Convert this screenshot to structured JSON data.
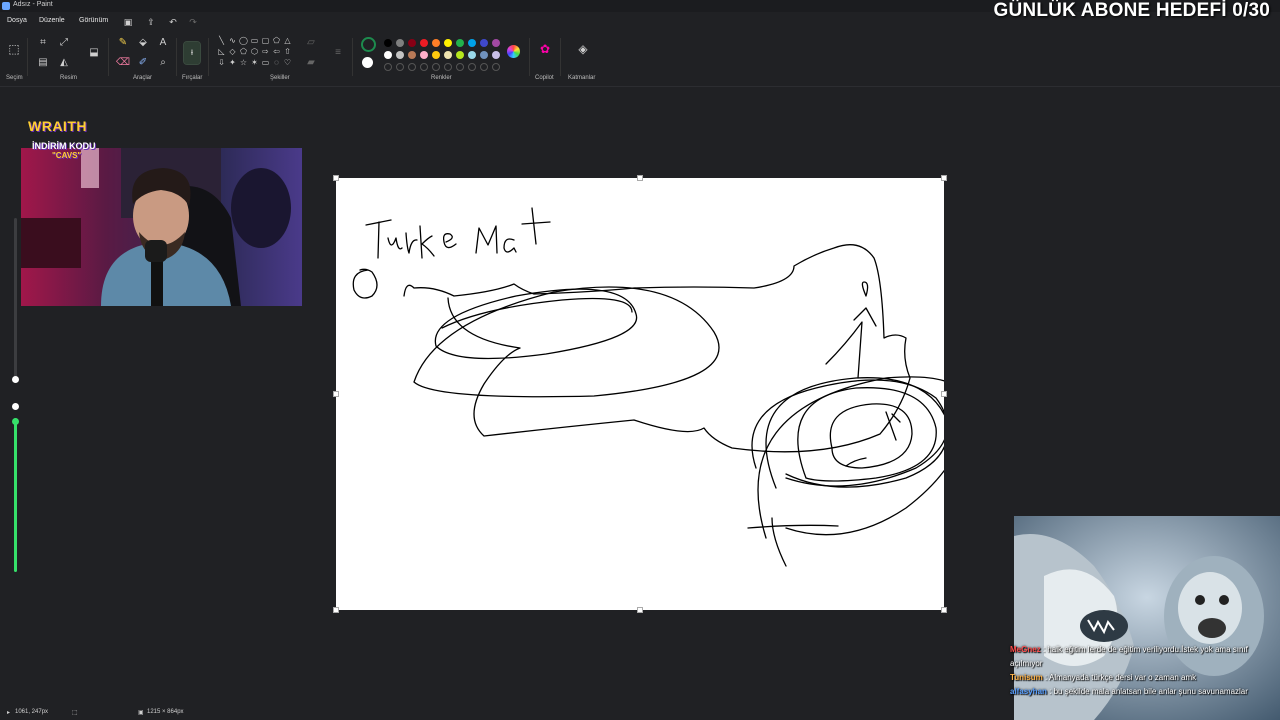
{
  "window": {
    "title": "Adsız - Paint"
  },
  "menu": {
    "file": "Dosya",
    "edit": "Düzenle",
    "view": "Görünüm"
  },
  "ribbon": {
    "groups": {
      "selection": "Seçim",
      "image": "Resim",
      "tools": "Araçlar",
      "brushes": "Fırçalar",
      "shapes": "Şekiller",
      "colors": "Renkler",
      "copilot": "Copilot",
      "layers": "Katmanlar"
    },
    "palette_row1": [
      "#000000",
      "#7f7f7f",
      "#880015",
      "#ed1c24",
      "#ff7f27",
      "#fff200",
      "#22b14c",
      "#00a2e8",
      "#3f48cc",
      "#a349a4"
    ],
    "palette_row2": [
      "#ffffff",
      "#c3c3c3",
      "#b97a57",
      "#ffaec9",
      "#ffc90e",
      "#efe4b0",
      "#b5e61d",
      "#99d9ea",
      "#7092be",
      "#c8bfe7"
    ],
    "accent_color": "#1d8b4e"
  },
  "status": {
    "cursor_position": "1061, 247px",
    "canvas_size": "1215 × 864px"
  },
  "overlay": {
    "goal_text": "GÜNLÜK ABONE HEDEFİ 0/30",
    "sponsor": {
      "brand": "WRAITH",
      "line": "İNDİRİM KODU",
      "code": "\"CAVS\""
    }
  },
  "drawing": {
    "text": "Türk e Mat"
  },
  "chat": [
    {
      "user": "MeGnez",
      "user_color": "#ff4d4d",
      "text": ": halk eğitim lerde de eğitim veriliyordu.İstek yok ama sınıf açılmıyor"
    },
    {
      "user": "Tunisum",
      "user_color": "#ffb347",
      "text": ": Almanyada türkçe dersi var o zaman amk"
    },
    {
      "user": "alfasyhan",
      "user_color": "#5aa0ff",
      "text": ": bu şekilde mala anlatsan bile anlar şunu savunamazlar"
    }
  ],
  "audio": {
    "mic_level": 0.0,
    "desktop_level": 1.0
  }
}
